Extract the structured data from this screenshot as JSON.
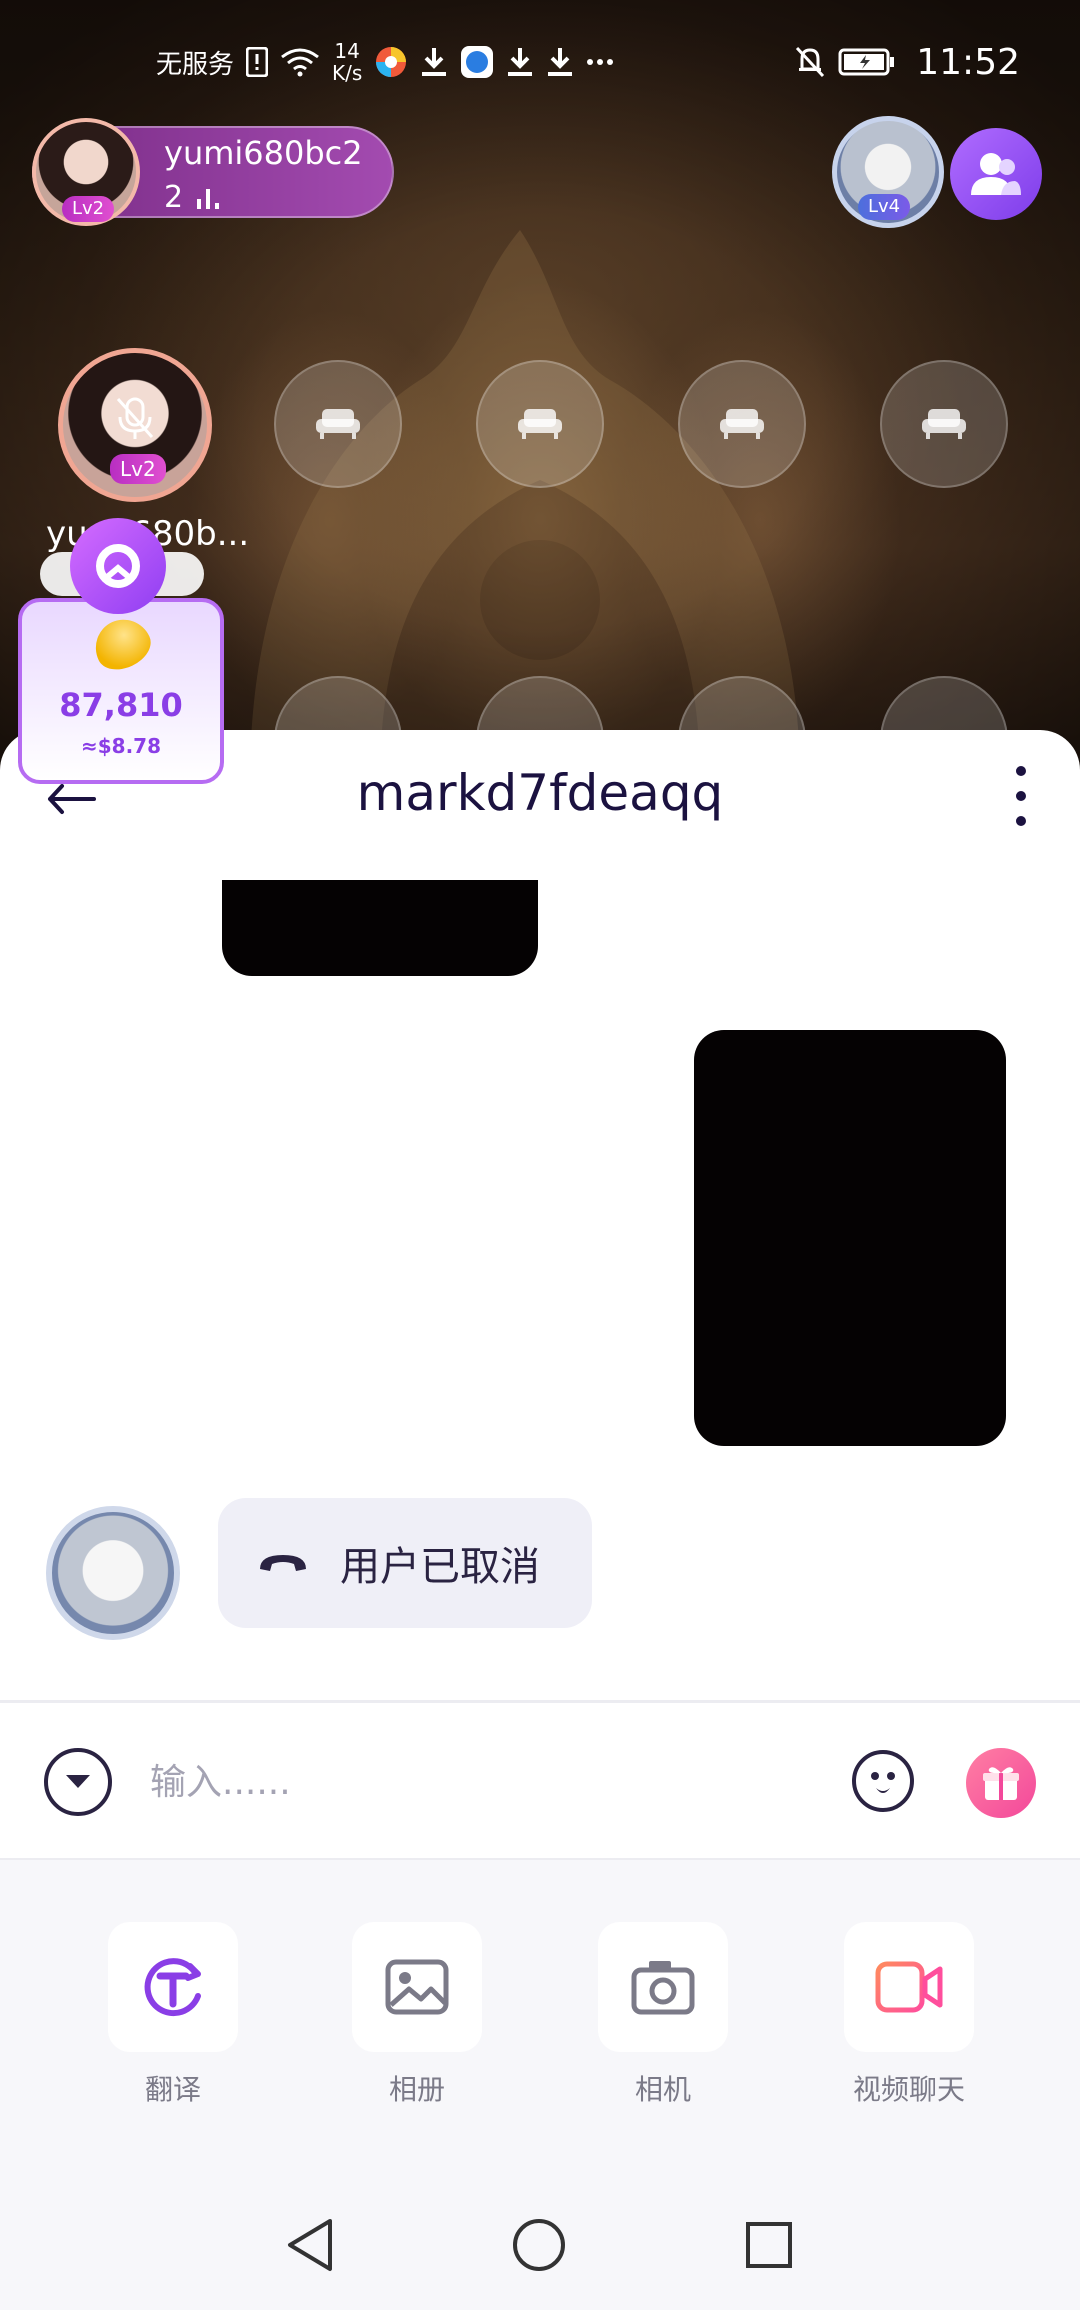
{
  "status_bar": {
    "carrier": "无服务",
    "speed_value": "14",
    "speed_unit": "K/s",
    "time": "11:52"
  },
  "room": {
    "host_name": "yumi680bc2",
    "host_level": "Lv2",
    "listener_count": "2",
    "right_level": "Lv4",
    "seat_user_name": "yumi680b...",
    "seat_user_level": "Lv2",
    "empty_seat_count": 4
  },
  "coin_widget": {
    "balance": "87,810",
    "usd_value": "≈$8.78"
  },
  "chat": {
    "title": "markd7fdeaqq",
    "call_status": "用户已取消"
  },
  "composer": {
    "placeholder": "输入......"
  },
  "tools": [
    {
      "label": "翻译",
      "icon": "translate-icon"
    },
    {
      "label": "相册",
      "icon": "album-icon"
    },
    {
      "label": "相机",
      "icon": "camera-icon"
    },
    {
      "label": "视频聊天",
      "icon": "video-call-icon"
    }
  ],
  "colors": {
    "accent": "#8a3ee6",
    "title": "#1b1240",
    "gift": "#f3489b",
    "video": "#ff5e8a"
  }
}
